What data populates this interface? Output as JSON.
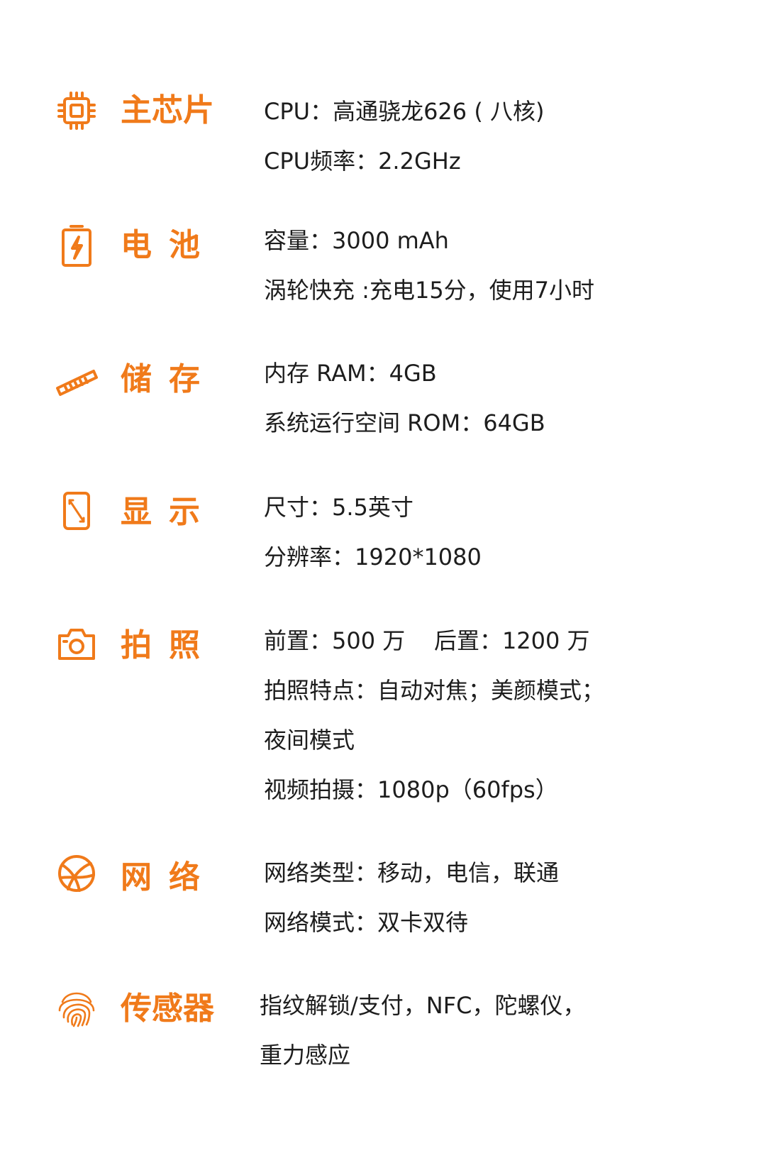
{
  "accent_color": "#f07a1a",
  "text_color": "#1d1d1d",
  "sections": [
    {
      "icon": "chip-icon",
      "label": "主芯片",
      "lines": [
        "CPU：高通骁龙626 ( 八核)",
        "CPU频率：2.2GHz"
      ]
    },
    {
      "icon": "battery-icon",
      "label": "电池",
      "lines": [
        "容量：3000 mAh",
        "涡轮快充 :充电15分，使用7小时"
      ]
    },
    {
      "icon": "memory-stick-icon",
      "label": "储存",
      "lines": [
        "内存 RAM：4GB",
        "系统运行空间 ROM：64GB"
      ]
    },
    {
      "icon": "phone-screen-icon",
      "label": "显示",
      "lines": [
        "尺寸：5.5英寸",
        "分辨率：1920*1080"
      ]
    },
    {
      "icon": "camera-icon",
      "label": "拍照",
      "lines": [
        "前置：500 万    后置：1200 万",
        "拍照特点：自动对焦；美颜模式；",
        "夜间模式",
        "视频拍摄：1080p（60fps）"
      ]
    },
    {
      "icon": "globe-icon",
      "label": "网络",
      "lines": [
        "网络类型：移动，电信，联通",
        "网络模式：双卡双待"
      ]
    },
    {
      "icon": "fingerprint-icon",
      "label": "传感器",
      "lines": [
        "指纹解锁/支付，NFC，陀螺仪，",
        "重力感应"
      ]
    }
  ]
}
